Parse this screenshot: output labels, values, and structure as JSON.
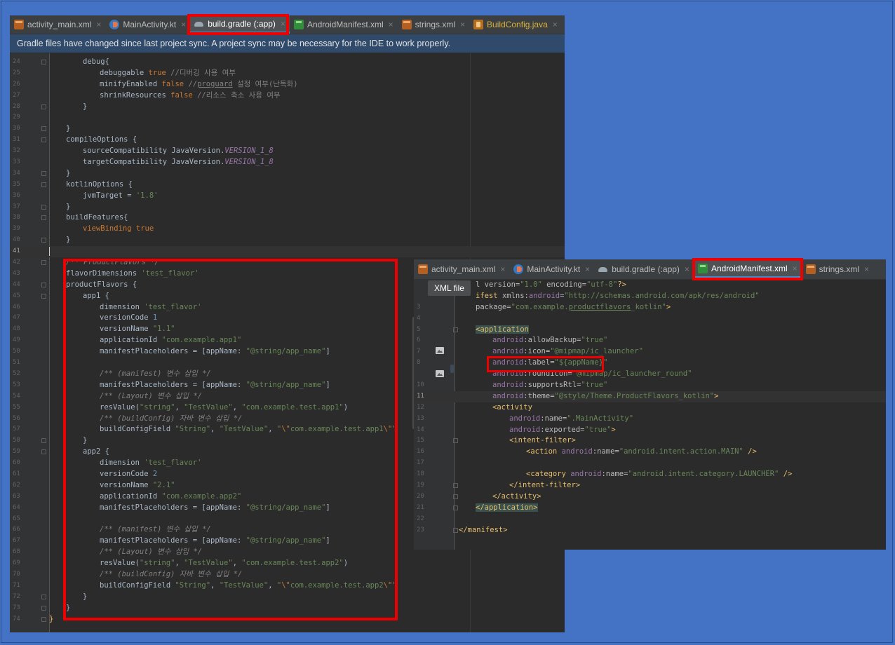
{
  "colors": {
    "background": "#4472c4",
    "editor_bg": "#2b2b2b",
    "highlight_box": "#ee0000"
  },
  "window1": {
    "tabs": [
      {
        "label": "activity_main.xml",
        "icon": "xml-file-icon",
        "active": false
      },
      {
        "label": "MainActivity.kt",
        "icon": "kotlin-file-icon",
        "active": false
      },
      {
        "label": "build.gradle (:app)",
        "icon": "gradle-icon",
        "active": true
      },
      {
        "label": "AndroidManifest.xml",
        "icon": "manifest-file-icon",
        "active": false
      },
      {
        "label": "strings.xml",
        "icon": "xml-file-icon",
        "active": false
      },
      {
        "label": "BuildConfig.java",
        "icon": "java-file-icon",
        "active": false
      }
    ],
    "banner": "Gradle files have changed since last project sync. A project sync may be necessary for the IDE to work properly.",
    "line_numbers": [
      "24",
      "25",
      "26",
      "27",
      "28",
      "29",
      "30",
      "31",
      "32",
      "33",
      "34",
      "35",
      "36",
      "37",
      "38",
      "39",
      "40",
      "41",
      "42",
      "43",
      "44",
      "45",
      "46",
      "47",
      "48",
      "49",
      "50",
      "51",
      "52",
      "53",
      "54",
      "55",
      "56",
      "57",
      "58",
      "59",
      "60",
      "61",
      "62",
      "63",
      "64",
      "65",
      "66",
      "67",
      "68",
      "69",
      "70",
      "71",
      "72",
      "73",
      "74"
    ]
  },
  "window2": {
    "tabs": [
      {
        "label": "activity_main.xml",
        "icon": "xml-file-icon",
        "active": false
      },
      {
        "label": "MainActivity.kt",
        "icon": "kotlin-file-icon",
        "active": false
      },
      {
        "label": "build.gradle (:app)",
        "icon": "gradle-icon",
        "active": false
      },
      {
        "label": "AndroidManifest.xml",
        "icon": "manifest-file-icon",
        "active": true
      },
      {
        "label": "strings.xml",
        "icon": "xml-file-icon",
        "active": false
      }
    ],
    "tooltip": "XML file",
    "line_numbers": [
      "",
      "",
      "3",
      "4",
      "5",
      "6",
      "7",
      "8",
      "",
      "10",
      "11",
      "12",
      "13",
      "14",
      "15",
      "16",
      "17",
      "18",
      "19",
      "20",
      "21",
      "22",
      "23"
    ]
  }
}
